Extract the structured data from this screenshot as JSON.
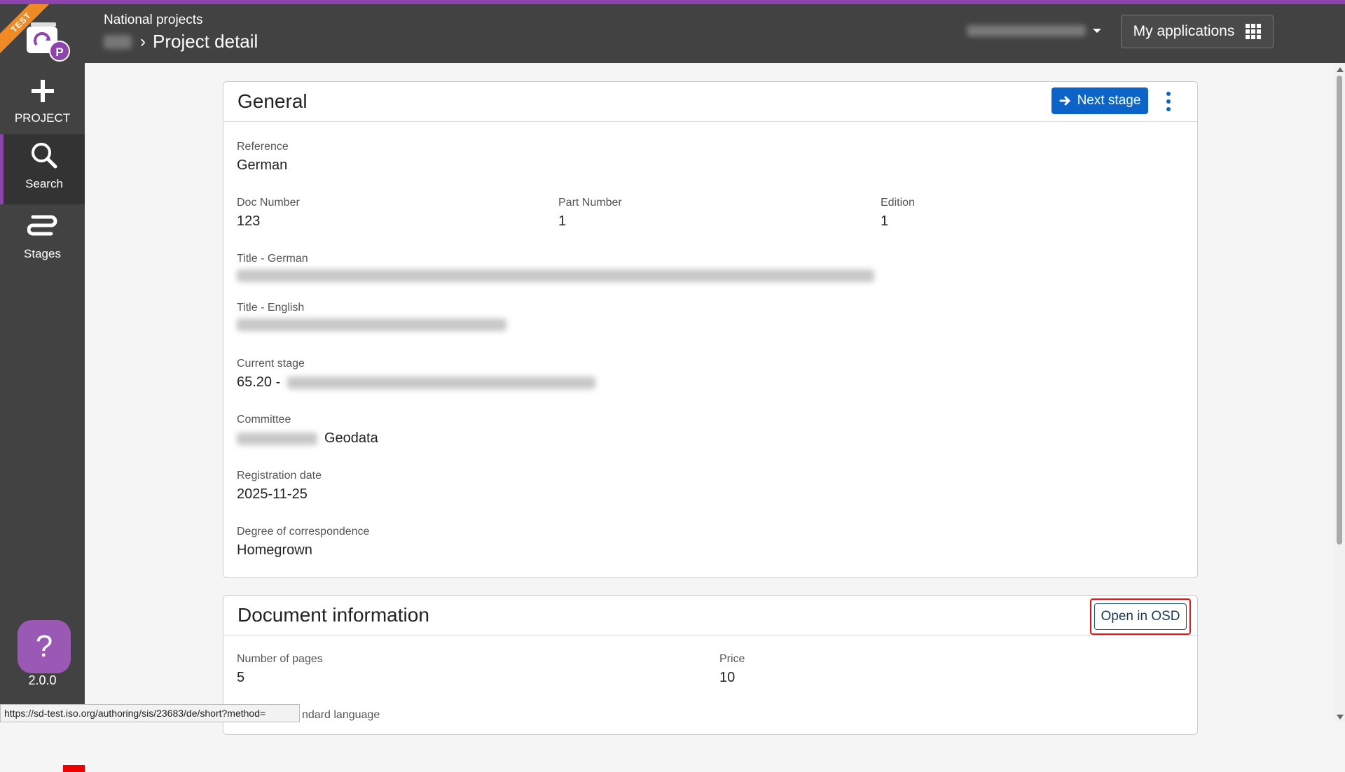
{
  "header": {
    "env_badge": "TEST",
    "logo_letter": "P",
    "app_name": "National projects",
    "breadcrumb_current": "Project detail",
    "my_apps_label": "My applications"
  },
  "sidebar": {
    "items": [
      {
        "label": "PROJECT",
        "icon": "plus-icon"
      },
      {
        "label": "Search",
        "icon": "search-icon"
      },
      {
        "label": "Stages",
        "icon": "stages-icon"
      }
    ],
    "help_label": "?",
    "version": "2.0.0"
  },
  "general": {
    "title": "General",
    "next_stage_label": "Next stage",
    "reference_label": "Reference",
    "reference_value": "German",
    "doc_number_label": "Doc Number",
    "doc_number_value": "123",
    "part_number_label": "Part Number",
    "part_number_value": "1",
    "edition_label": "Edition",
    "edition_value": "1",
    "title_german_label": "Title - German",
    "title_english_label": "Title - English",
    "current_stage_label": "Current stage",
    "current_stage_value": "65.20 -",
    "committee_label": "Committee",
    "committee_value": "Geodata",
    "registration_date_label": "Registration date",
    "registration_date_value": "2025-11-25",
    "degree_label": "Degree of correspondence",
    "degree_value": "Homegrown"
  },
  "document_info": {
    "title": "Document information",
    "open_osd_label": "Open in OSD",
    "pages_label": "Number of pages",
    "pages_value": "5",
    "price_label": "Price",
    "price_value": "10",
    "standard_language_label": "ndard language"
  },
  "status_bar": {
    "url": "https://sd-test.iso.org/authoring/sis/23683/de/short?method="
  },
  "colors": {
    "accent_purple": "#8e44ad",
    "primary_blue": "#0d64c8",
    "topbar_bg": "#424242",
    "highlight_red": "#e11111"
  }
}
